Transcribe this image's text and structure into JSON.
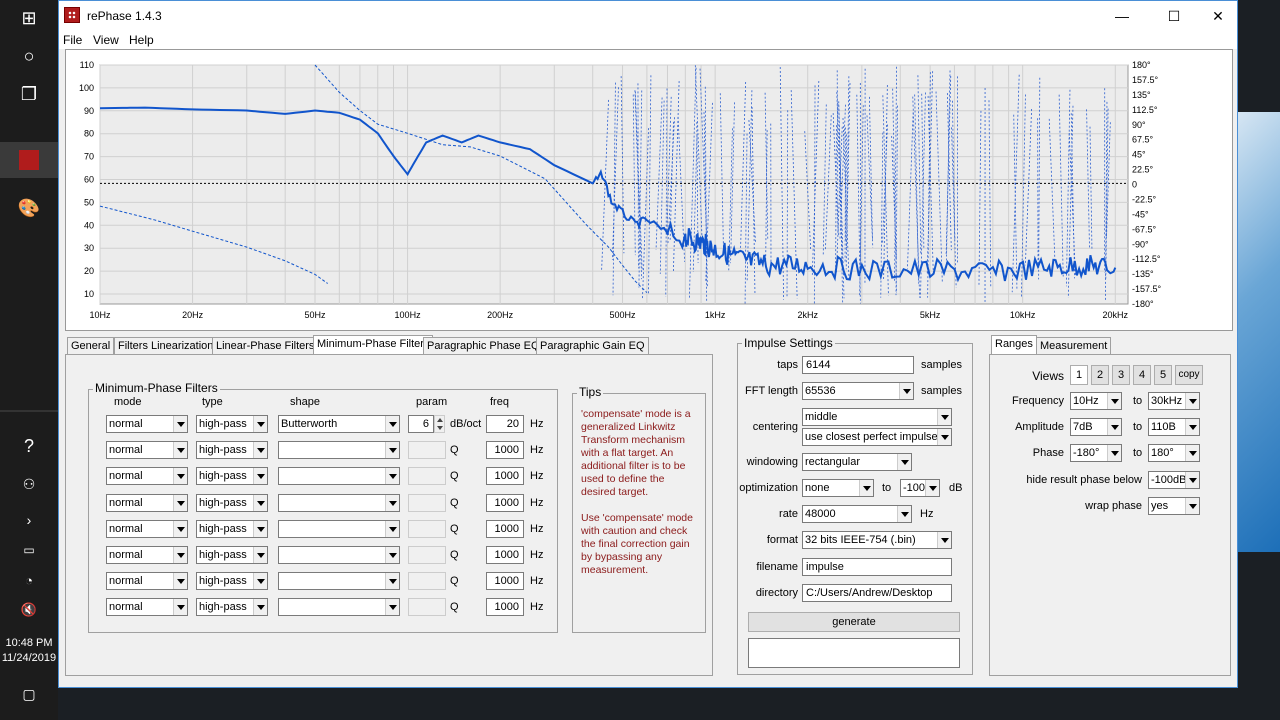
{
  "window": {
    "title": "rePhase 1.4.3",
    "minimize": "—",
    "maximize": "☐",
    "close": "✕"
  },
  "menu": [
    "File",
    "View",
    "Help"
  ],
  "taskbar": {
    "time": "10:48 PM",
    "date": "11/24/2019"
  },
  "chart_data": {
    "type": "line",
    "x_scale": "log",
    "xlim": [
      10,
      22000
    ],
    "ylim": [
      5,
      110
    ],
    "x_ticks": [
      {
        "v": 10,
        "label": "10Hz"
      },
      {
        "v": 20,
        "label": "20Hz"
      },
      {
        "v": 50,
        "label": "50Hz"
      },
      {
        "v": 100,
        "label": "100Hz"
      },
      {
        "v": 200,
        "label": "200Hz"
      },
      {
        "v": 500,
        "label": "500Hz"
      },
      {
        "v": 1000,
        "label": "1kHz"
      },
      {
        "v": 2000,
        "label": "2kHz"
      },
      {
        "v": 5000,
        "label": "5kHz"
      },
      {
        "v": 10000,
        "label": "10kHz"
      },
      {
        "v": 20000,
        "label": "20kHz"
      }
    ],
    "y_left_ticks": [
      "110",
      "100",
      "90",
      "80",
      "70",
      "60",
      "50",
      "40",
      "30",
      "20",
      "10"
    ],
    "y_right_ticks": [
      "180°",
      "157.5°",
      "135°",
      "112.5°",
      "90°",
      "67.5°",
      "45°",
      "22.5°",
      "0",
      "-22.5°",
      "-45°",
      "-67.5°",
      "-90°",
      "-112.5°",
      "-135°",
      "-157.5°",
      "-180°"
    ],
    "zero_phase_line": 58,
    "grid": true,
    "series": [
      {
        "style": "solid",
        "color": "#1155cc",
        "points": [
          [
            10,
            91
          ],
          [
            14,
            91.3
          ],
          [
            20,
            90.5
          ],
          [
            30,
            90
          ],
          [
            40,
            88.5
          ],
          [
            50,
            90
          ],
          [
            60,
            89
          ],
          [
            70,
            86
          ],
          [
            80,
            80
          ],
          [
            90,
            70
          ],
          [
            100,
            62
          ],
          [
            105,
            67
          ],
          [
            115,
            76
          ],
          [
            130,
            79
          ],
          [
            150,
            76
          ],
          [
            170,
            79
          ],
          [
            200,
            76
          ],
          [
            250,
            73
          ],
          [
            300,
            66
          ],
          [
            400,
            58
          ],
          [
            430,
            62
          ],
          [
            460,
            50
          ],
          [
            500,
            45
          ],
          [
            550,
            40
          ],
          [
            600,
            42
          ],
          [
            700,
            36
          ],
          [
            800,
            34
          ],
          [
            900,
            32
          ],
          [
            1000,
            29
          ],
          [
            1200,
            25
          ],
          [
            1500,
            22
          ],
          [
            2000,
            22
          ],
          [
            3000,
            20
          ],
          [
            5000,
            20
          ],
          [
            8000,
            19
          ],
          [
            12000,
            21
          ],
          [
            16000,
            22
          ],
          [
            20000,
            21
          ]
        ]
      },
      {
        "style": "dashed",
        "color": "#1155cc",
        "points": [
          [
            10,
            48
          ],
          [
            15,
            42
          ],
          [
            20,
            37
          ],
          [
            30,
            30
          ],
          [
            40,
            24
          ],
          [
            50,
            18
          ],
          [
            55,
            14
          ]
        ]
      },
      {
        "style": "dashed",
        "color": "#1155cc",
        "points": [
          [
            50,
            110
          ],
          [
            60,
            98
          ],
          [
            70,
            90
          ],
          [
            80,
            84
          ],
          [
            100,
            80
          ],
          [
            130,
            75
          ],
          [
            160,
            74
          ],
          [
            200,
            70
          ],
          [
            280,
            60
          ],
          [
            380,
            40
          ],
          [
            450,
            30
          ],
          [
            500,
            22
          ],
          [
            550,
            15
          ],
          [
            600,
            10
          ]
        ]
      }
    ]
  },
  "tabs": [
    "General",
    "Filters Linearization",
    "Linear-Phase Filters",
    "Minimum-Phase Filters",
    "Paragraphic Phase EQ",
    "Paragraphic Gain EQ"
  ],
  "mp": {
    "group_title": "Minimum-Phase Filters",
    "headers": {
      "mode": "mode",
      "type": "type",
      "shape": "shape",
      "param": "param",
      "freq": "freq"
    },
    "rows": [
      {
        "mode": "normal",
        "type": "high-pass",
        "shape": "Butterworth",
        "param": "6",
        "param_unit": "dB/oct",
        "freq": "20",
        "freq_unit": "Hz"
      },
      {
        "mode": "normal",
        "type": "high-pass",
        "shape": "",
        "param": "",
        "param_unit": "Q",
        "freq": "1000",
        "freq_unit": "Hz"
      },
      {
        "mode": "normal",
        "type": "high-pass",
        "shape": "",
        "param": "",
        "param_unit": "Q",
        "freq": "1000",
        "freq_unit": "Hz"
      },
      {
        "mode": "normal",
        "type": "high-pass",
        "shape": "",
        "param": "",
        "param_unit": "Q",
        "freq": "1000",
        "freq_unit": "Hz"
      },
      {
        "mode": "normal",
        "type": "high-pass",
        "shape": "",
        "param": "",
        "param_unit": "Q",
        "freq": "1000",
        "freq_unit": "Hz"
      },
      {
        "mode": "normal",
        "type": "high-pass",
        "shape": "",
        "param": "",
        "param_unit": "Q",
        "freq": "1000",
        "freq_unit": "Hz"
      },
      {
        "mode": "normal",
        "type": "high-pass",
        "shape": "",
        "param": "",
        "param_unit": "Q",
        "freq": "1000",
        "freq_unit": "Hz"
      },
      {
        "mode": "normal",
        "type": "high-pass",
        "shape": "",
        "param": "",
        "param_unit": "Q",
        "freq": "1000",
        "freq_unit": "Hz"
      }
    ]
  },
  "tips": {
    "title": "Tips",
    "p1": "'compensate' mode is a generalized Linkwitz Transform mechanism with a flat target. An additional filter is to be used to define the desired target.",
    "p2": "Use 'compensate' mode with caution and check the final correction gain by bypassing any measurement."
  },
  "impulse": {
    "title": "Impulse Settings",
    "taps_label": "taps",
    "taps": "6144",
    "taps_unit": "samples",
    "fft_label": "FFT length",
    "fft": "65536",
    "fft_unit": "samples",
    "centering_label": "centering",
    "centering": "middle",
    "centering2": "use closest perfect impulse",
    "windowing_label": "windowing",
    "windowing": "rectangular",
    "opt_label": "optimization",
    "opt": "none",
    "opt_to": "to",
    "opt_val": "-100",
    "opt_unit": "dB",
    "rate_label": "rate",
    "rate": "48000",
    "rate_unit": "Hz",
    "format_label": "format",
    "format": "32 bits IEEE-754 (.bin)",
    "filename_label": "filename",
    "filename": "impulse",
    "directory_label": "directory",
    "directory": "C:/Users/Andrew/Desktop",
    "generate": "generate"
  },
  "ranges": {
    "tabs": [
      "Ranges",
      "Measurement"
    ],
    "views_label": "Views",
    "views": [
      "1",
      "2",
      "3",
      "4",
      "5"
    ],
    "copy": "copy",
    "freq_label": "Frequency",
    "freq_from": "10Hz",
    "freq_to": "30kHz",
    "amp_label": "Amplitude",
    "amp_from": "7dB",
    "amp_to": "110B",
    "phase_label": "Phase",
    "phase_from": "-180°",
    "phase_to": "180°",
    "to": "to",
    "hide_label": "hide result phase below",
    "hide": "-100dB",
    "wrap_label": "wrap phase",
    "wrap": "yes"
  }
}
